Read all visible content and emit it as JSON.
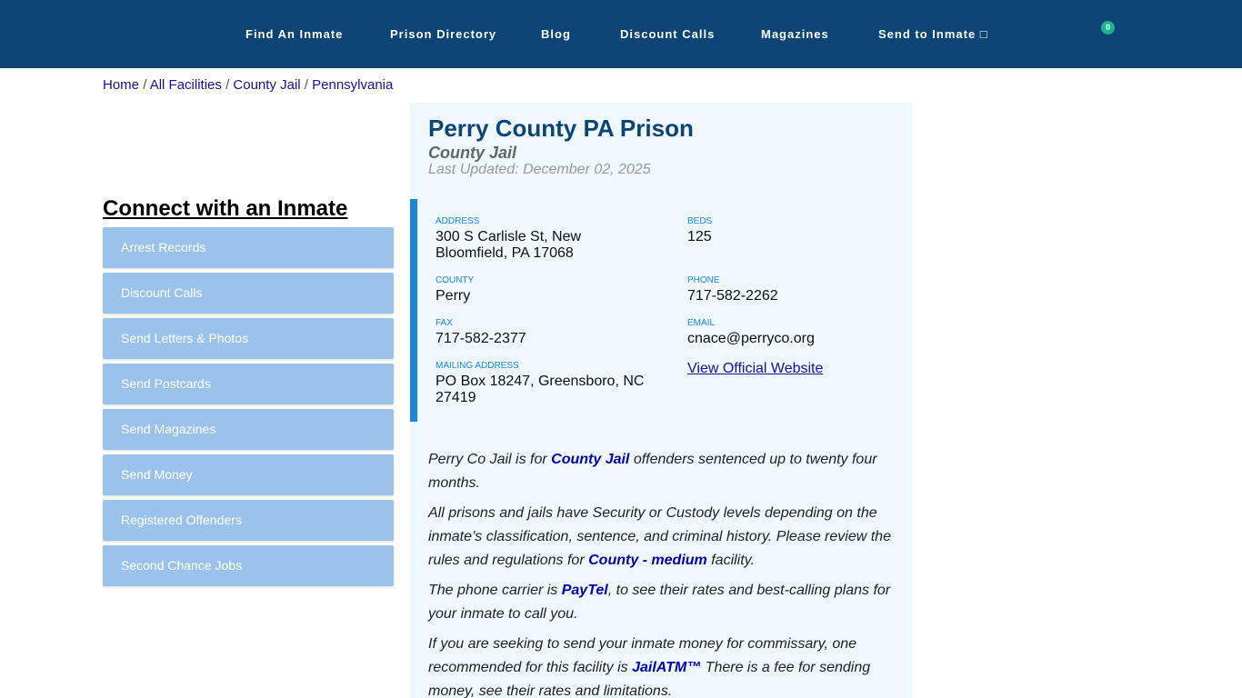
{
  "nav": {
    "items": [
      "Find An Inmate",
      "Prison Directory",
      "Blog",
      "Discount Calls",
      "Magazines",
      "Send to Inmate □"
    ],
    "cart_count": "0"
  },
  "breadcrumb": {
    "items": [
      "Home",
      "All Facilities",
      "County Jail",
      "Pennsylvania"
    ],
    "separator": "/"
  },
  "sidebar": {
    "title": "Connect with an Inmate",
    "items": [
      "Arrest Records",
      "Discount Calls",
      "Send Letters & Photos",
      "Send Postcards",
      "Send Magazines",
      "Send Money",
      "Registered Offenders",
      "Second Chance Jobs"
    ]
  },
  "facility": {
    "title": "Perry County PA Prison",
    "type": "County Jail",
    "updated": "Last Updated: December 02, 2025"
  },
  "info": {
    "address_label": "ADDRESS",
    "address": "300 S Carlisle St, New Bloomfield, PA 17068",
    "beds_label": "BEDS",
    "beds": "125",
    "county_label": "COUNTY",
    "county": "Perry",
    "phone_label": "PHONE",
    "phone": "717-582-2262",
    "fax_label": "FAX",
    "fax": "717-582-2377",
    "email_label": "EMAIL",
    "email": "cnace@perryco.org",
    "mailing_label": "MAILING ADDRESS",
    "mailing": "PO Box 18247, Greensboro, NC 27419",
    "website_link": "View Official Website"
  },
  "description": {
    "p1_a": "Perry Co Jail is for ",
    "p1_link": "County Jail",
    "p1_b": " offenders sentenced up to twenty four months.",
    "p2_a": "All prisons and jails have Security or Custody levels depending on the inmate’s classification, sentence, and criminal history. Please review the rules and regulations for ",
    "p2_link": "County - medium",
    "p2_b": " facility.",
    "p3_a": "The phone carrier is ",
    "p3_link": "PayTel",
    "p3_b": ", to see their rates and best-calling plans for your inmate to call you.",
    "p4_a": "If you are seeking to send your inmate money for commissary, one recommended for this facility is ",
    "p4_link": "JailATM™",
    "p4_b": " There is a fee for sending money, see their rates and limitations."
  }
}
